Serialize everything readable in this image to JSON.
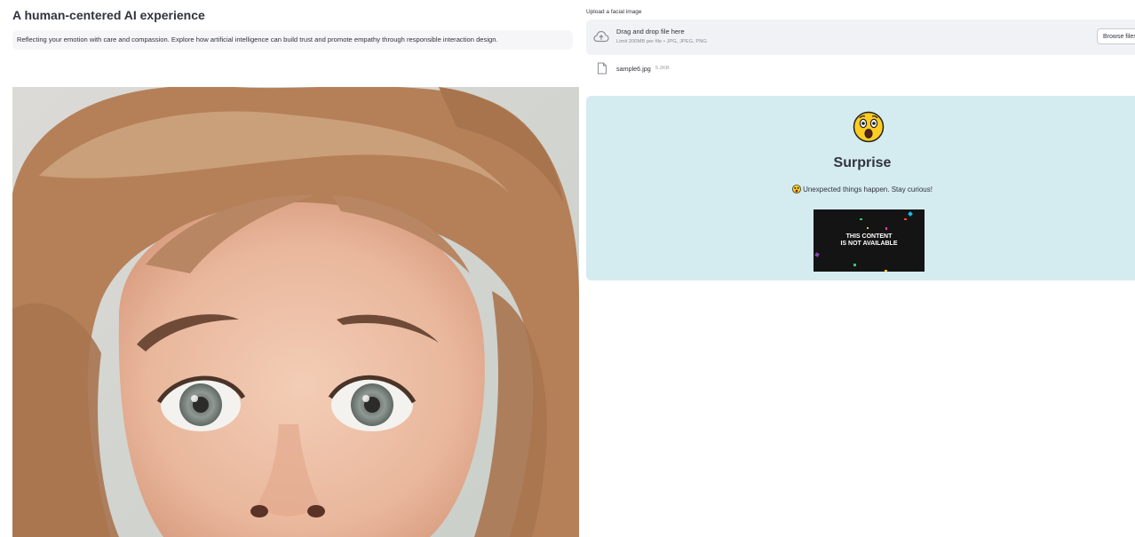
{
  "header": {
    "title": "A human-centered AI experience",
    "intro": "Reflecting your emotion with care and compassion. Explore how artificial intelligence can build trust and promote empathy through responsible interaction design."
  },
  "uploader": {
    "label": "Upload a facial image",
    "drop_text": "Drag and drop file here",
    "limit_text": "Limit 200MB per file • JPG, JPEG, PNG",
    "browse_label": "Browse files",
    "file": {
      "name": "sample6.jpg",
      "size": "5.2KB"
    }
  },
  "result": {
    "emoji_icon": "astonished-face-icon",
    "emotion": "Surprise",
    "message": "Unexpected things happen. Stay curious!",
    "media_text_line1": "THIS CONTENT",
    "media_text_line2": "IS NOT AVAILABLE",
    "card_color": "#d4ecef"
  },
  "photo": {
    "subject": "woman-surprised-face-photo"
  }
}
